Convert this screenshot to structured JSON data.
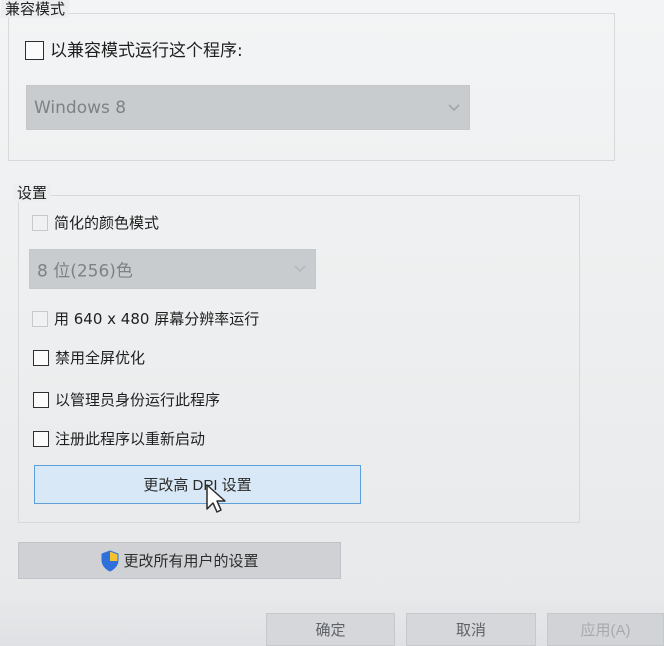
{
  "compatibility": {
    "title": "兼容模式",
    "run_in_compat_label": "以兼容模式运行这个程序:",
    "os_dropdown_value": "Windows 8"
  },
  "settings": {
    "title": "设置",
    "simplified_color_label": "简化的颜色模式",
    "color_dropdown_value": "8 位(256)色",
    "resolution_label": "用 640 x 480 屏幕分辨率运行",
    "disable_fullscreen_label": "禁用全屏优化",
    "run_as_admin_label": "以管理员身份运行此程序",
    "register_restart_label": "注册此程序以重新启动",
    "change_dpi_button": "更改高 DPI 设置"
  },
  "change_all_users_button": "更改所有用户的设置",
  "footer": {
    "ok": "确定",
    "cancel": "取消",
    "apply": "应用(A)"
  },
  "colors": {
    "dpi_button_border": "#5f9fd8",
    "dpi_button_fill": "#d9e8f6",
    "shield_blue": "#2f6fdb",
    "shield_yellow": "#f2c230"
  },
  "icons": {
    "dropdown": "chevron-down-icon",
    "shield": "shield-icon",
    "cursor": "mouse-cursor-icon"
  }
}
